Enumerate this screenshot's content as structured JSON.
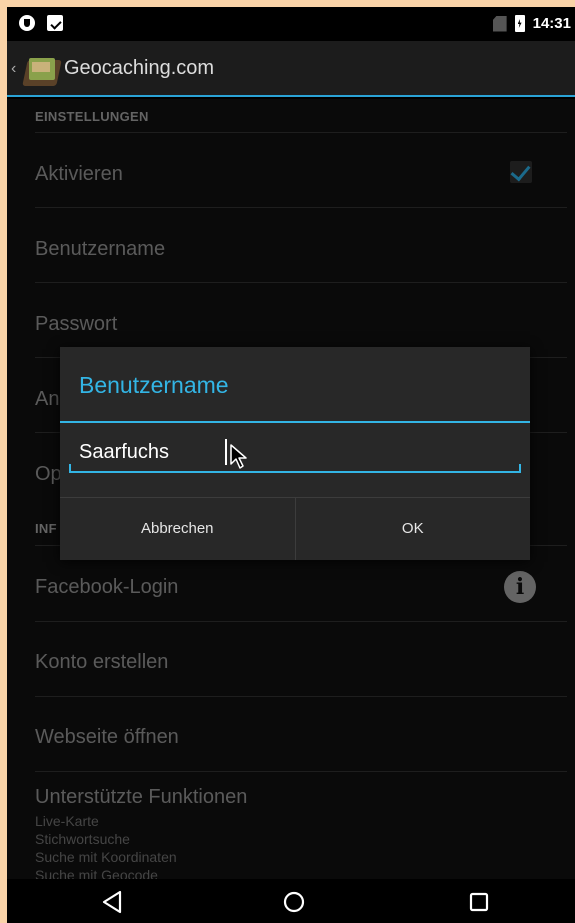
{
  "status_bar": {
    "time": "14:31"
  },
  "action_bar": {
    "back_glyph": "‹",
    "title": "Geocaching.com"
  },
  "settings": {
    "section_settings": "EINSTELLUNGEN",
    "enable_label": "Aktivieren",
    "enable_checked": true,
    "username_label": "Benutzername",
    "password_label": "Passwort",
    "partial_an": "An",
    "partial_op": "Op",
    "partial_inf": "INF",
    "facebook_login_label": "Facebook-Login",
    "info_glyph": "i",
    "create_account_label": "Konto erstellen",
    "open_website_label": "Webseite öffnen",
    "supported_functions_label": "Unterstützte Funktionen",
    "supported_functions": [
      "Live-Karte",
      "Stichwortsuche",
      "Suche mit Koordinaten",
      "Suche mit Geocode"
    ]
  },
  "dialog": {
    "title": "Benutzername",
    "input_value": "Saarfuchs",
    "cancel_label": "Abbrechen",
    "ok_label": "OK"
  },
  "colors": {
    "accent": "#33b5e5",
    "background": "#101010"
  },
  "icons": {
    "status_left": [
      "shield-icon",
      "clipboard-check-icon"
    ],
    "status_right": [
      "no-sim-icon",
      "battery-charging-icon"
    ],
    "nav": [
      "nav-back-icon",
      "nav-home-icon",
      "nav-recents-icon"
    ]
  }
}
